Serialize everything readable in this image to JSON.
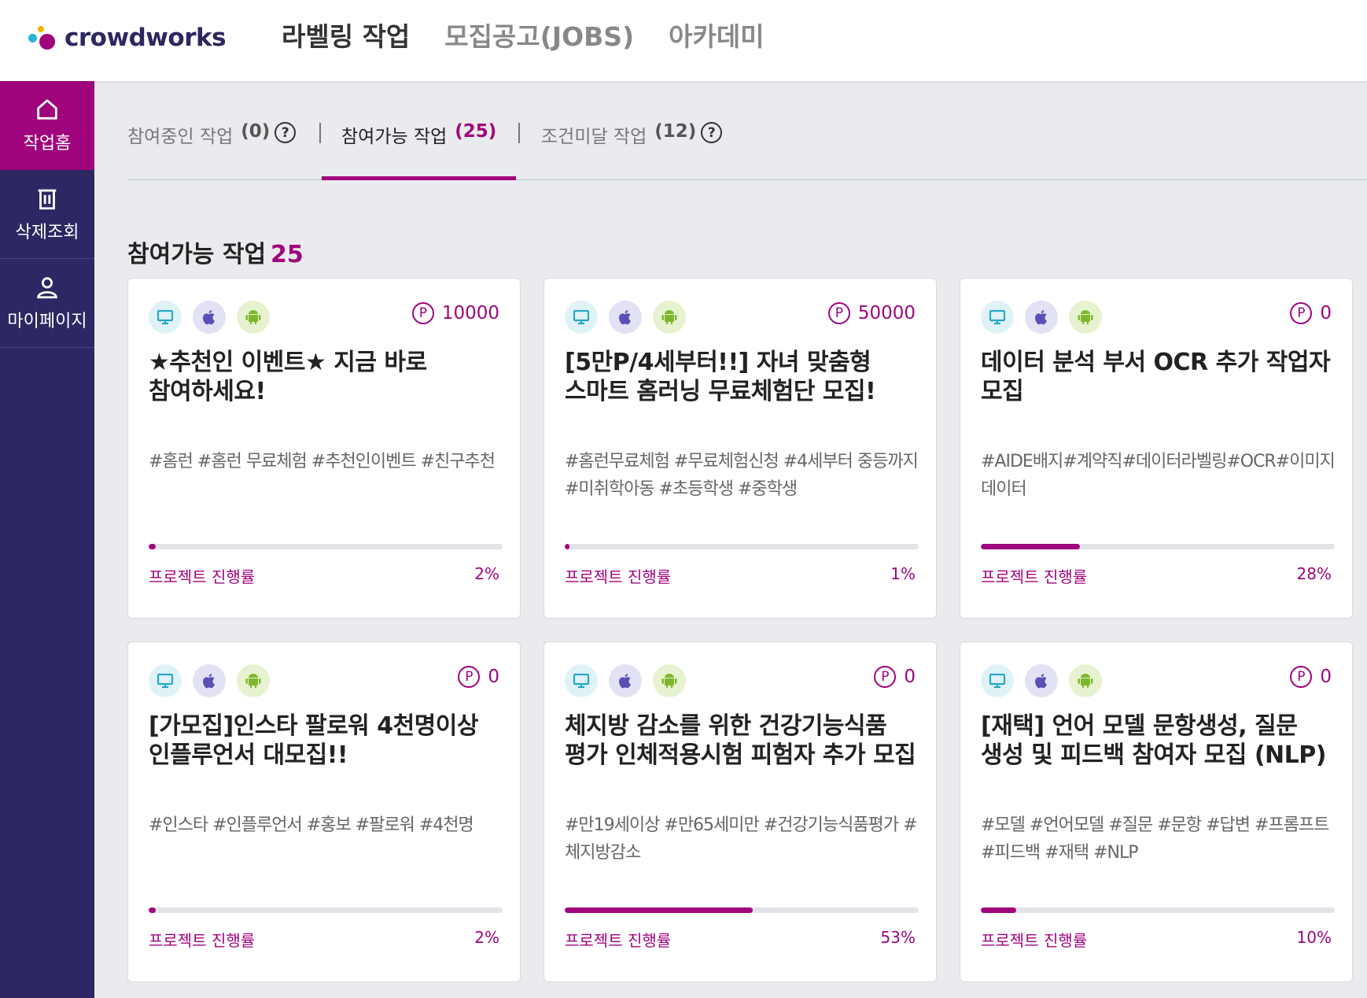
{
  "header": {
    "logo_text": "crowdworks",
    "nav": [
      {
        "label": "라벨링 작업",
        "active": true
      },
      {
        "label": "모집공고(JOBS)",
        "active": false
      },
      {
        "label": "아카데미",
        "active": false
      }
    ]
  },
  "sidebar": {
    "items": [
      {
        "label": "작업홈",
        "icon": "home-icon",
        "active": true
      },
      {
        "label": "삭제조회",
        "icon": "trash-icon",
        "active": false
      },
      {
        "label": "마이페이지",
        "icon": "user-icon",
        "active": false
      }
    ]
  },
  "tabs": [
    {
      "label": "참여중인 작업",
      "count": "(0)",
      "help": "?"
    },
    {
      "label": "참여가능 작업",
      "count": "(25)"
    },
    {
      "label": "조건미달 작업",
      "count": "(12)",
      "help": "?"
    }
  ],
  "section": {
    "title": "참여가능 작업",
    "count": "25"
  },
  "progress_label": "프로젝트 진행률",
  "point_symbol": "P",
  "colors": {
    "brand": "#a0047c",
    "sidebar": "#2d2763",
    "background": "#e9ebee"
  },
  "cards": [
    {
      "point": "10000",
      "title": "★추천인 이벤트★ 지금 바로 참여하세요!",
      "tags": "#홈런 #홈런 무료체험 #추천인이벤트 #친구추천",
      "progress": 0.02,
      "progress_text": "2%"
    },
    {
      "point": "50000",
      "title": "[5만P/4세부터!!] 자녀 맞춤형 스마트 홈러닝 무료체험단 모집!",
      "tags": "#홈런무료체험 #무료체험신청 #4세부터 중등까지 #미취학아동 #초등학생 #중학생",
      "progress": 0.01,
      "progress_text": "1%"
    },
    {
      "point": "0",
      "title": "데이터 분석 부서 OCR 추가 작업자 모집",
      "tags": "#AIDE배지#계약직#데이터라벨링#OCR#이미지데이터",
      "progress": 0.28,
      "progress_text": "28%"
    },
    {
      "point": "0",
      "title": "[가모집]인스타 팔로워 4천명이상 인플루언서 대모집!!",
      "tags": "#인스타 #인플루언서 #홍보 #팔로워 #4천명",
      "progress": 0.02,
      "progress_text": "2%"
    },
    {
      "point": "0",
      "title": "체지방 감소를 위한 건강기능식품 평가 인체적용시험 피험자 추가 모집",
      "tags": "#만19세이상 #만65세미만 #건강기능식품평가 #체지방감소",
      "progress": 0.53,
      "progress_text": "53%"
    },
    {
      "point": "0",
      "title": "[재택] 언어 모델 문항생성, 질문 생성 및 피드백 참여자 모집 (NLP)",
      "tags": "#모델 #언어모델 #질문 #문항 #답변 #프롬프트 #피드백 #재택 #NLP",
      "progress": 0.1,
      "progress_text": "10%"
    }
  ]
}
